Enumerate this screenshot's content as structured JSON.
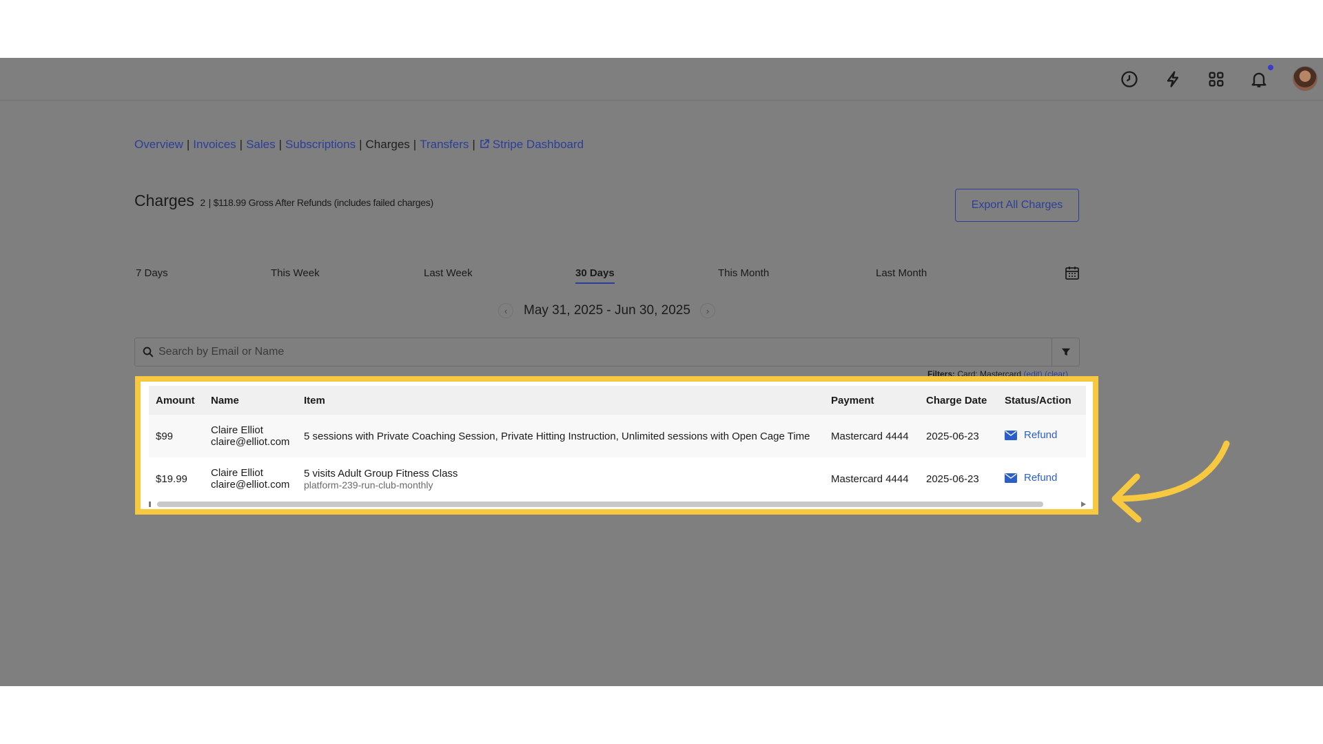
{
  "subnav": {
    "items": [
      "Overview",
      "Invoices",
      "Sales",
      "Subscriptions",
      "Charges",
      "Transfers",
      "Stripe Dashboard"
    ],
    "separator": "|"
  },
  "header": {
    "title": "Charges",
    "count": "2",
    "summary": "| $118.99 Gross After Refunds (includes failed charges)",
    "export_label": "Export All Charges"
  },
  "ranges": [
    "7 Days",
    "This Week",
    "Last Week",
    "30 Days",
    "This Month",
    "Last Month"
  ],
  "active_range": "30 Days",
  "date_range": {
    "text": "May 31, 2025 - Jun 30, 2025",
    "prev": "‹",
    "next": "›"
  },
  "search": {
    "placeholder": "Search by Email or Name"
  },
  "filters_line": {
    "label": "Filters:",
    "value": "Card: Mastercard",
    "edit": "(edit)",
    "clear": "(clear)"
  },
  "table": {
    "headers": [
      "Amount",
      "Name",
      "Item",
      "Payment",
      "Charge Date",
      "Status/Action"
    ],
    "rows": [
      {
        "amount": "$99",
        "name": "Claire Elliot",
        "email": "claire@elliot.com",
        "item": "5 sessions with Private Coaching Session, Private Hitting Instruction, Unlimited sessions with Open Cage Time",
        "item_sub": "",
        "payment": "Mastercard 4444",
        "date": "2025-06-23",
        "action": "Refund"
      },
      {
        "amount": "$19.99",
        "name": "Claire Elliot",
        "email": "claire@elliot.com",
        "item": "5 visits Adult Group Fitness Class",
        "item_sub": "platform-239-run-club-monthly",
        "payment": "Mastercard 4444",
        "date": "2025-06-23",
        "action": "Refund"
      }
    ]
  },
  "colors": {
    "highlight": "#f7c940",
    "link": "#2b3f9a",
    "overlay": "#7f7f7f"
  },
  "icons": [
    "clock-icon",
    "bolt-icon",
    "apps-grid-icon",
    "bell-icon",
    "external-link-icon",
    "calendar-icon",
    "search-icon",
    "filter-icon",
    "mail-icon",
    "curved-arrow-icon"
  ]
}
